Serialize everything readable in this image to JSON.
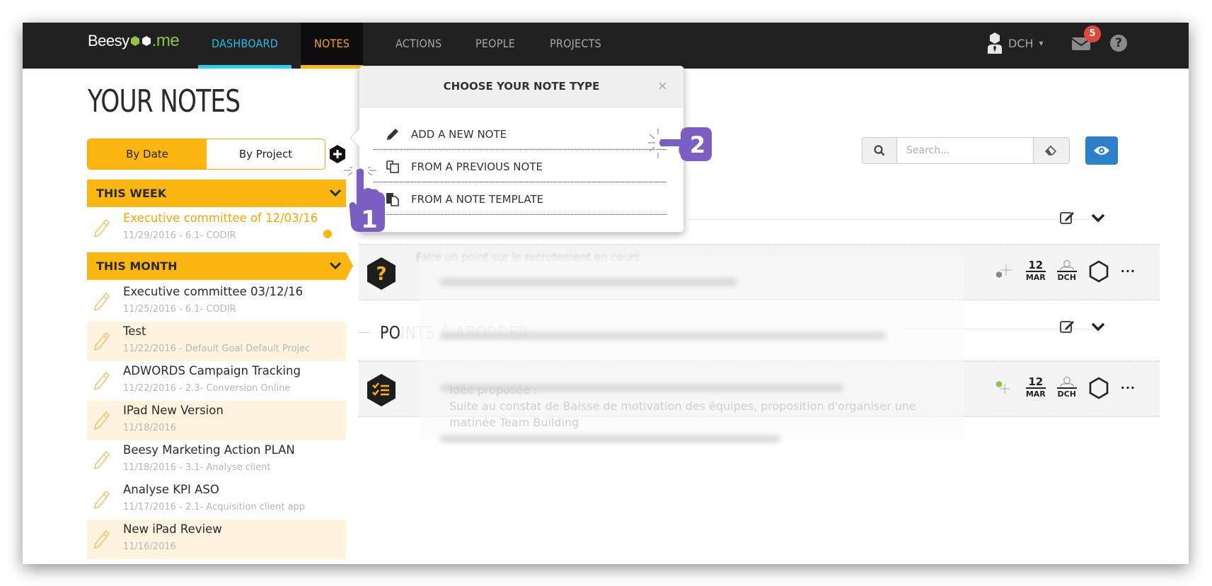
{
  "app": {
    "logo_text": "Beesy",
    "logo_suffix": ".me",
    "brand_colors": {
      "orange": "#fbb611",
      "cyan": "#2dcff0",
      "green": "#8dc63f",
      "navy": "#212121",
      "blue_button": "#2c7fc9",
      "badge_red": "#e2473e",
      "tutorial_purple": "#7b5ec1"
    }
  },
  "nav": {
    "items": [
      {
        "label": "DASHBOARD",
        "state": "hover"
      },
      {
        "label": "NOTES",
        "state": "active"
      },
      {
        "label": "ACTIONS",
        "state": "normal"
      },
      {
        "label": "PEOPLE",
        "state": "normal"
      },
      {
        "label": "PROJECTS",
        "state": "normal"
      }
    ],
    "user": {
      "initials": "DCH",
      "icon": "user-tie-icon",
      "caret": "▾"
    },
    "mail": {
      "icon": "envelope-icon",
      "unread_count": "5"
    },
    "help": {
      "icon": "question-circle-icon",
      "label": "?"
    }
  },
  "sidebar": {
    "title": "YOUR NOTES",
    "view_toggle": {
      "options": [
        "By Date",
        "By Project"
      ],
      "selected": "By Date"
    },
    "add_button_icon": "plus-hexagon-icon",
    "groups": [
      {
        "label": "THIS WEEK",
        "chevron": "⌄",
        "notes": [
          {
            "title": "Executive committee of 12/03/16",
            "date": "11/29/2016",
            "project": "6.1- CODIR",
            "current": true
          }
        ]
      },
      {
        "label": "THIS MONTH",
        "chevron": "⌄",
        "notes": [
          {
            "title": "Executive committee 03/12/16",
            "date": "11/25/2016",
            "project": "6.1- CODIR"
          },
          {
            "title": "Test",
            "date": "11/22/2016",
            "project": "Default Goal Default Projec"
          },
          {
            "title": "ADWORDS Campaign Tracking",
            "date": "11/22/2016",
            "project": "2.3- Conversion Online"
          },
          {
            "title": "IPad New Version",
            "date": "11/18/2016",
            "project": ""
          },
          {
            "title": "Beesy Marketing Action PLAN",
            "date": "11/18/2016",
            "project": "3.1- Analyse client"
          },
          {
            "title": "Analyse KPI ASO",
            "date": "11/17/2016",
            "project": "2.1- Acquisition client app"
          },
          {
            "title": "New iPad Review",
            "date": "11/16/2016",
            "project": ""
          }
        ]
      }
    ],
    "separator": " - "
  },
  "popover": {
    "title": "CHOOSE YOUR NOTE TYPE",
    "close_label": "×",
    "options": [
      {
        "label": "ADD A NEW NOTE",
        "icon": "pencil-icon"
      },
      {
        "label": "FROM A PREVIOUS NOTE",
        "icon": "copy-icon"
      },
      {
        "label": "FROM A NOTE TEMPLATE",
        "icon": "template-icon"
      }
    ]
  },
  "toolbar": {
    "search_placeholder": "Search...",
    "search_value": "",
    "search_icon": "search-icon",
    "clear_icon": "eraser-icon",
    "view_icon": "eye-icon"
  },
  "content": {
    "section_heading": "POINTS À ABORDER",
    "entries": [
      {
        "type_icon": "question-hexagon-icon",
        "text": "Faire un point sur le recrutement en cours",
        "status_icon": "gray-hexagon-plus-icon",
        "date_day": "12",
        "date_month": "MAR",
        "owner": "DCH",
        "more_label": "···"
      },
      {
        "type_icon": "checklist-hexagon-icon",
        "text": "Idée proposée :",
        "text_line2": "Suite au constat de Baisse de motivation des équipes, proposition d'organiser une",
        "text_line3": "matinée Team Building",
        "status_icon": "green-hexagon-plus-icon",
        "date_day": "12",
        "date_month": "MAR",
        "owner": "DCH",
        "more_label": "···"
      }
    ]
  },
  "tutorial": {
    "step1_label": "1",
    "step2_label": "2"
  }
}
